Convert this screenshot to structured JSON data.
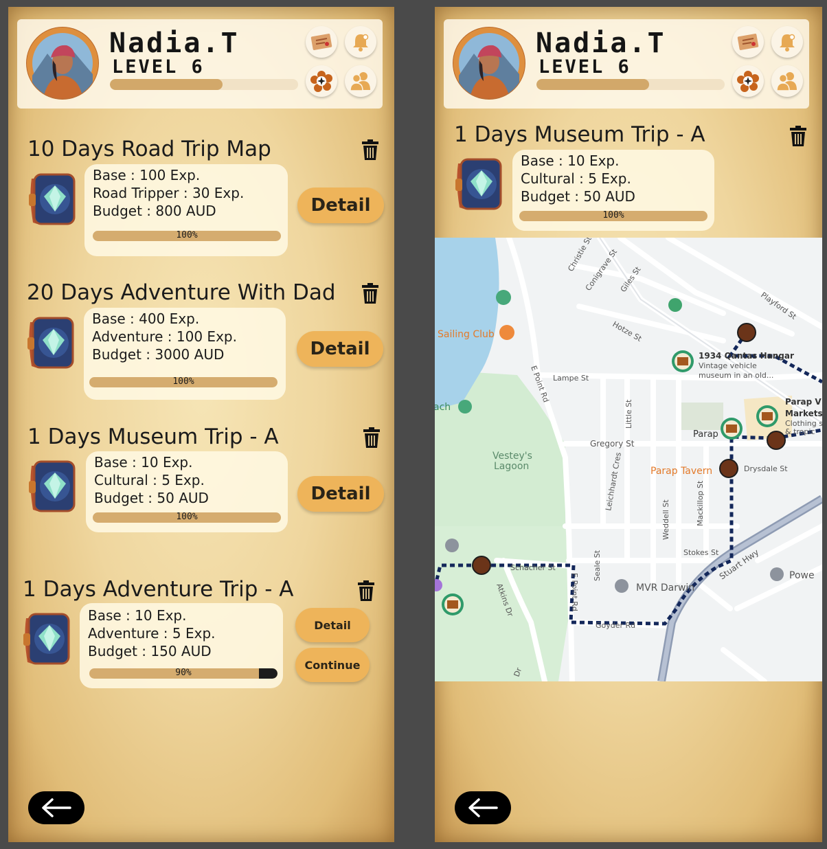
{
  "profile": {
    "name": "Nadia.T",
    "level": "LEVEL 6",
    "xp_progress": 0.6
  },
  "header_icons": [
    "scroll-map-icon",
    "bell-icon",
    "compass-icon",
    "friends-icon"
  ],
  "left": {
    "trips": [
      {
        "title": "10 Days Road Trip Map",
        "base": "Base : 100 Exp.",
        "bonus": "Road Tripper : 30 Exp.",
        "budget": "Budget : 800 AUD",
        "progress_label": "100%",
        "progress": 1.0,
        "detail_label": "Detail"
      },
      {
        "title": "20 Days Adventure With Dad",
        "base": "Base : 400 Exp.",
        "bonus": "Adventure : 100 Exp.",
        "budget": "Budget : 3000 AUD",
        "progress_label": "100%",
        "progress": 1.0,
        "detail_label": "Detail"
      },
      {
        "title": "1 Days Museum Trip - A",
        "base": "Base : 10 Exp.",
        "bonus": "Cultural : 5 Exp.",
        "budget": "Budget  : 50 AUD",
        "progress_label": "100%",
        "progress": 1.0,
        "detail_label": "Detail"
      },
      {
        "title": "1 Days Adventure Trip - A",
        "base": "Base : 10 Exp.",
        "bonus": "Adventure : 5 Exp.",
        "budget": "Budget  :  150 AUD",
        "progress_label": "90%",
        "progress": 0.9,
        "detail_label": "Detail",
        "continue_label": "Continue"
      }
    ]
  },
  "right": {
    "trip": {
      "title": "1 Days Museum Trip - A",
      "base": "Base : 10 Exp.",
      "bonus": "Cultural : 5 Exp.",
      "budget": "Budget  : 50 AUD",
      "progress_label": "100%",
      "progress": 1.0
    },
    "map": {
      "labels": {
        "sailing_club": "Sailing Club",
        "beach": "ach",
        "lagoon_1": "Vestey's",
        "lagoon_2": "Lagoon",
        "qantas_1": "1934 Qantas Hangar",
        "qantas_2": "Vintage vehicle",
        "qantas_3": "museum in an old...",
        "parap": "Parap",
        "parap_markets_1": "Parap V",
        "parap_markets_2": "Markets",
        "parap_markets_3": "Clothing s",
        "parap_markets_4": "& tropic",
        "parap_tavern": "Parap Tavern",
        "mvr": "MVR Darwin",
        "power": "Powe",
        "streets": {
          "christie": "Christie St",
          "conigrave": "Conigrave St",
          "giles": "Giles St",
          "playford": "Playford St",
          "hotze": "Hotze St",
          "e_point": "E Point Rd",
          "lampe": "Lampe St",
          "little": "Little St",
          "gregory": "Gregory St",
          "drysdale": "Drysdale St",
          "leichhardt": "Leichhardt Cres",
          "mackillop": "Mackillop St",
          "weddell": "Weddell St",
          "stokes": "Stokes St",
          "stuart": "Stuart Hwy",
          "seale": "Seale St",
          "schacher": "Schacher St",
          "atkins": "Atkins Dr",
          "e_point_2": "E Point Rd",
          "goyder": "Goyder Rd",
          "dr": "Dr"
        }
      }
    }
  },
  "colors": {
    "accent": "#eeb45a",
    "bar": "#d5ac6f",
    "route": "#13275a",
    "stop": "#6b3419",
    "water": "#a7d2ea",
    "park": "#d3ecd2"
  }
}
